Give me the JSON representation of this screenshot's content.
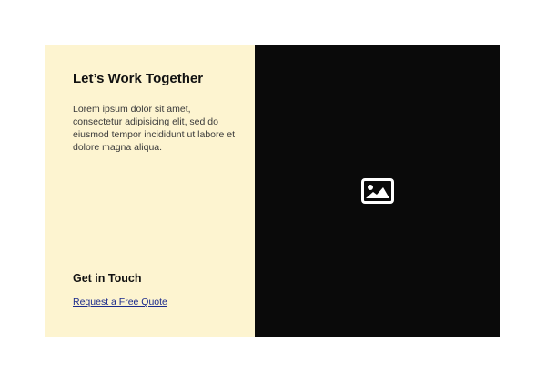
{
  "content": {
    "heading": "Let’s Work Together",
    "body": "Lorem ipsum dolor sit amet, consectetur adipisicing elit, sed do eiusmod tempor incididunt ut labore et dolore magna aliqua.",
    "subheading": "Get in Touch",
    "cta_label": "Request a Free Quote"
  },
  "media": {
    "icon": "image-placeholder-icon"
  },
  "colors": {
    "left_panel_bg": "#fdf4d0",
    "right_panel_bg": "#0a0a0a",
    "link": "#1a2a8c",
    "heading": "#111111",
    "body_text": "#3a3a3a"
  }
}
